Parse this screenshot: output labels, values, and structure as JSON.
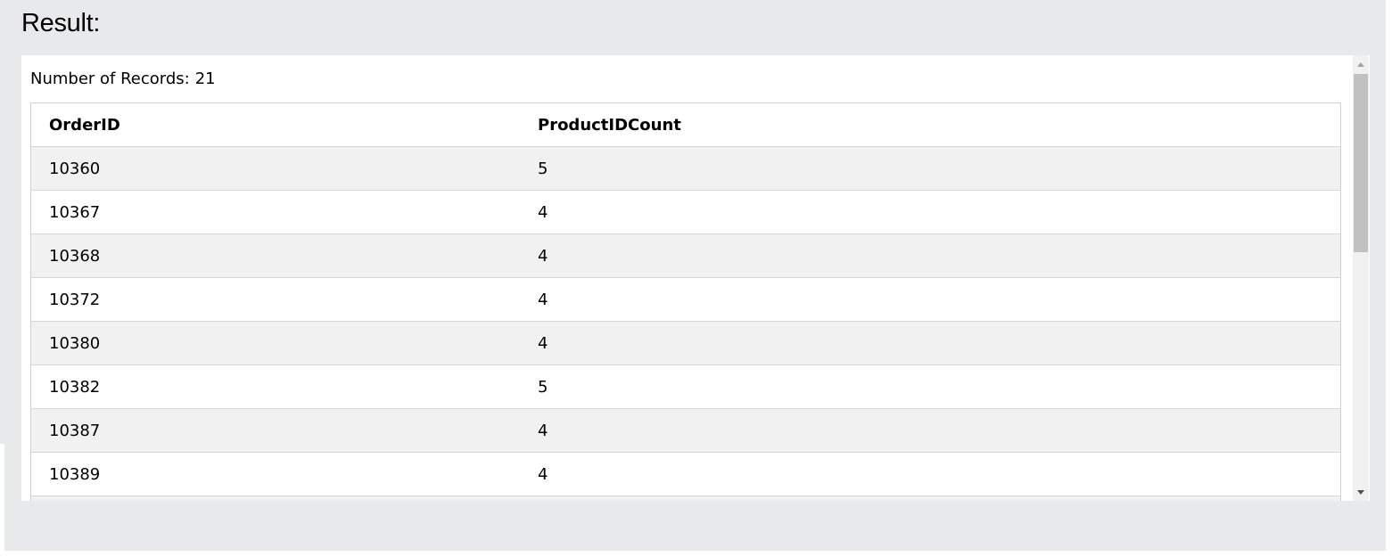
{
  "result": {
    "title": "Result:",
    "records_label": "Number of Records:",
    "records_count": "21"
  },
  "table": {
    "columns": [
      "OrderID",
      "ProductIDCount"
    ],
    "rows": [
      [
        "10360",
        "5"
      ],
      [
        "10367",
        "4"
      ],
      [
        "10368",
        "4"
      ],
      [
        "10372",
        "4"
      ],
      [
        "10380",
        "4"
      ],
      [
        "10382",
        "5"
      ],
      [
        "10387",
        "4"
      ],
      [
        "10389",
        "4"
      ]
    ]
  },
  "scrollbar": {
    "up_icon": "triangle-up-icon",
    "down_icon": "triangle-down-icon"
  }
}
